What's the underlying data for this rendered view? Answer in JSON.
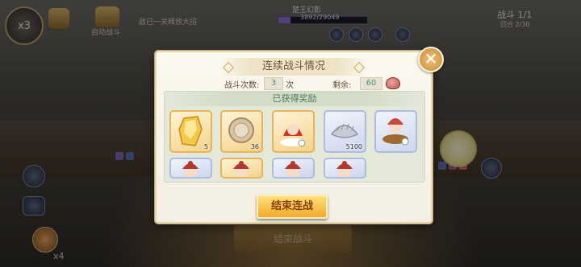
{
  "hud": {
    "speed_label": "x3",
    "hint_text": "敌已一关释放大招",
    "auto_label": "自动战斗",
    "boss_name": "楚王幻影",
    "boss_hp": "3892/29049",
    "boss_hp_fraction": 0.134,
    "battle_label": "战斗 1/1",
    "round_label": "回合 2/30",
    "multiplier_label": "x4",
    "bottom_button_label": "结束战斗"
  },
  "dialog": {
    "title": "连续战斗情况",
    "battle_count_label": "战斗次数:",
    "battle_count_value": "3",
    "battle_count_unit": "次",
    "remaining_label": "剩余:",
    "remaining_value": "60",
    "rewards_header": "已获得奖励",
    "finish_button": "结束连战",
    "close_icon": "close-icon"
  },
  "rewards": [
    {
      "icon": "gold-crystal-icon",
      "count": "5",
      "frame": "gold"
    },
    {
      "icon": "copper-coin-icon",
      "count": "36",
      "frame": "gold"
    },
    {
      "icon": "red-hood-doll-icon",
      "count": "",
      "frame": "gold"
    },
    {
      "icon": "silver-dumpling-icon",
      "count": "5100",
      "frame": "blue"
    },
    {
      "icon": "chef-bun-icon",
      "count": "",
      "frame": "blue"
    },
    {
      "icon": "chef-portrait-icon",
      "count": "",
      "frame": "blue"
    },
    {
      "icon": "chef-portrait-icon",
      "count": "",
      "frame": "gold"
    },
    {
      "icon": "chef-portrait-icon",
      "count": "",
      "frame": "blue"
    },
    {
      "icon": "chef-portrait-icon",
      "count": "",
      "frame": "blue"
    }
  ],
  "colors": {
    "accent_green": "#4d8f7a",
    "button_gold": "#f0a92c",
    "title_brown": "#6e5731"
  }
}
